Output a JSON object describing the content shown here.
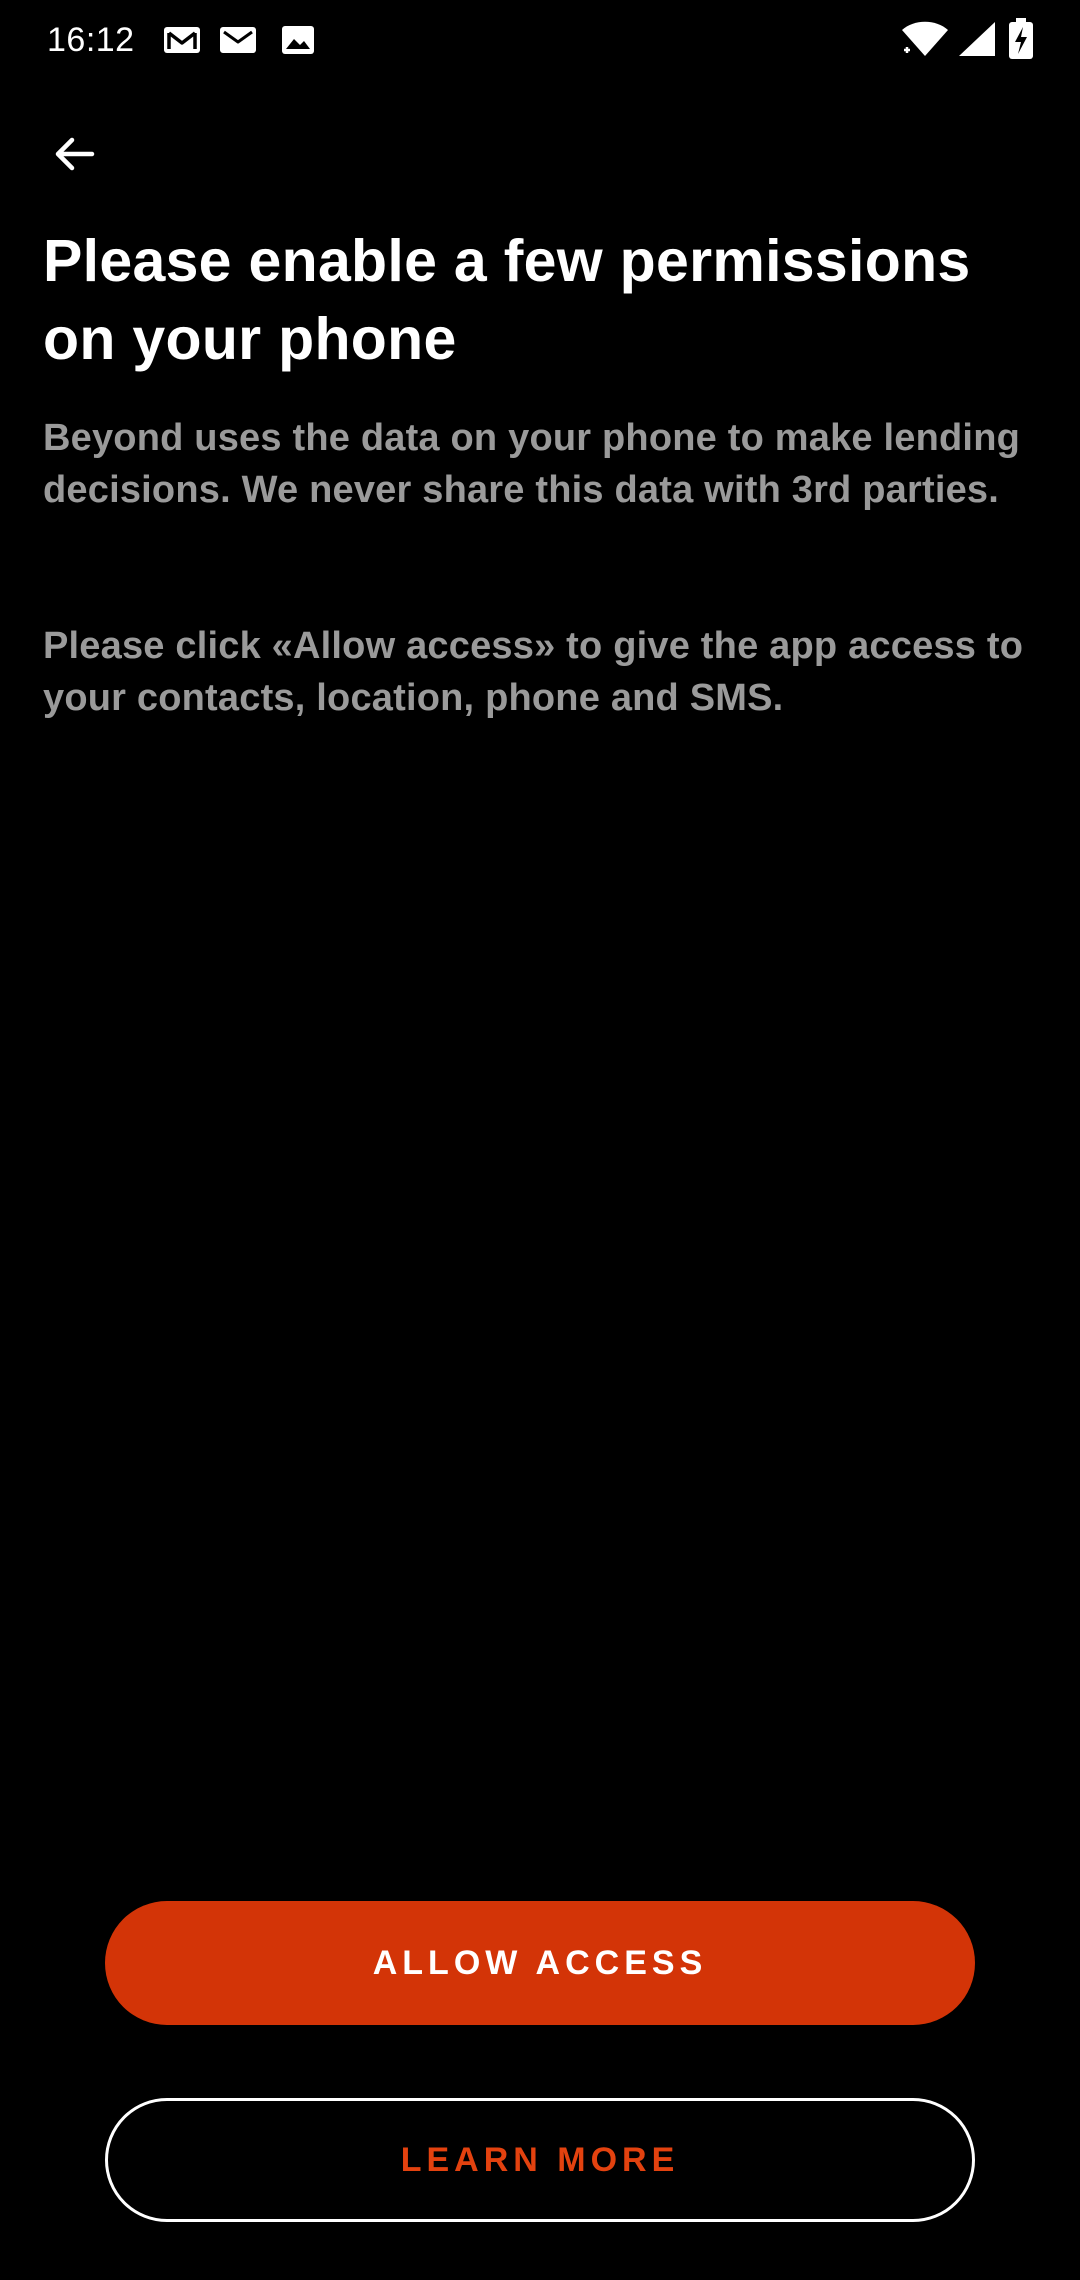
{
  "status_bar": {
    "time": "16:12",
    "notification_icons": [
      "gmail-icon",
      "mail-icon",
      "image-icon"
    ],
    "system_icons": [
      "wifi-icon",
      "signal-icon",
      "battery-charging-icon"
    ]
  },
  "header": {
    "back_icon": "arrow-back-icon"
  },
  "content": {
    "title": "Please enable a few permissions on your phone",
    "paragraph_1": "Beyond uses the data on your phone to make lending decisions. We never share this data with 3rd parties.",
    "paragraph_2": "Please click «Allow access» to give the app access to your contacts, location, phone and SMS."
  },
  "actions": {
    "allow_label": "ALLOW ACCESS",
    "learn_more_label": "LEARN MORE"
  },
  "colors": {
    "background": "#000000",
    "accent": "#d33407",
    "body_text": "#9a9a9a",
    "title_text": "#ffffff"
  }
}
